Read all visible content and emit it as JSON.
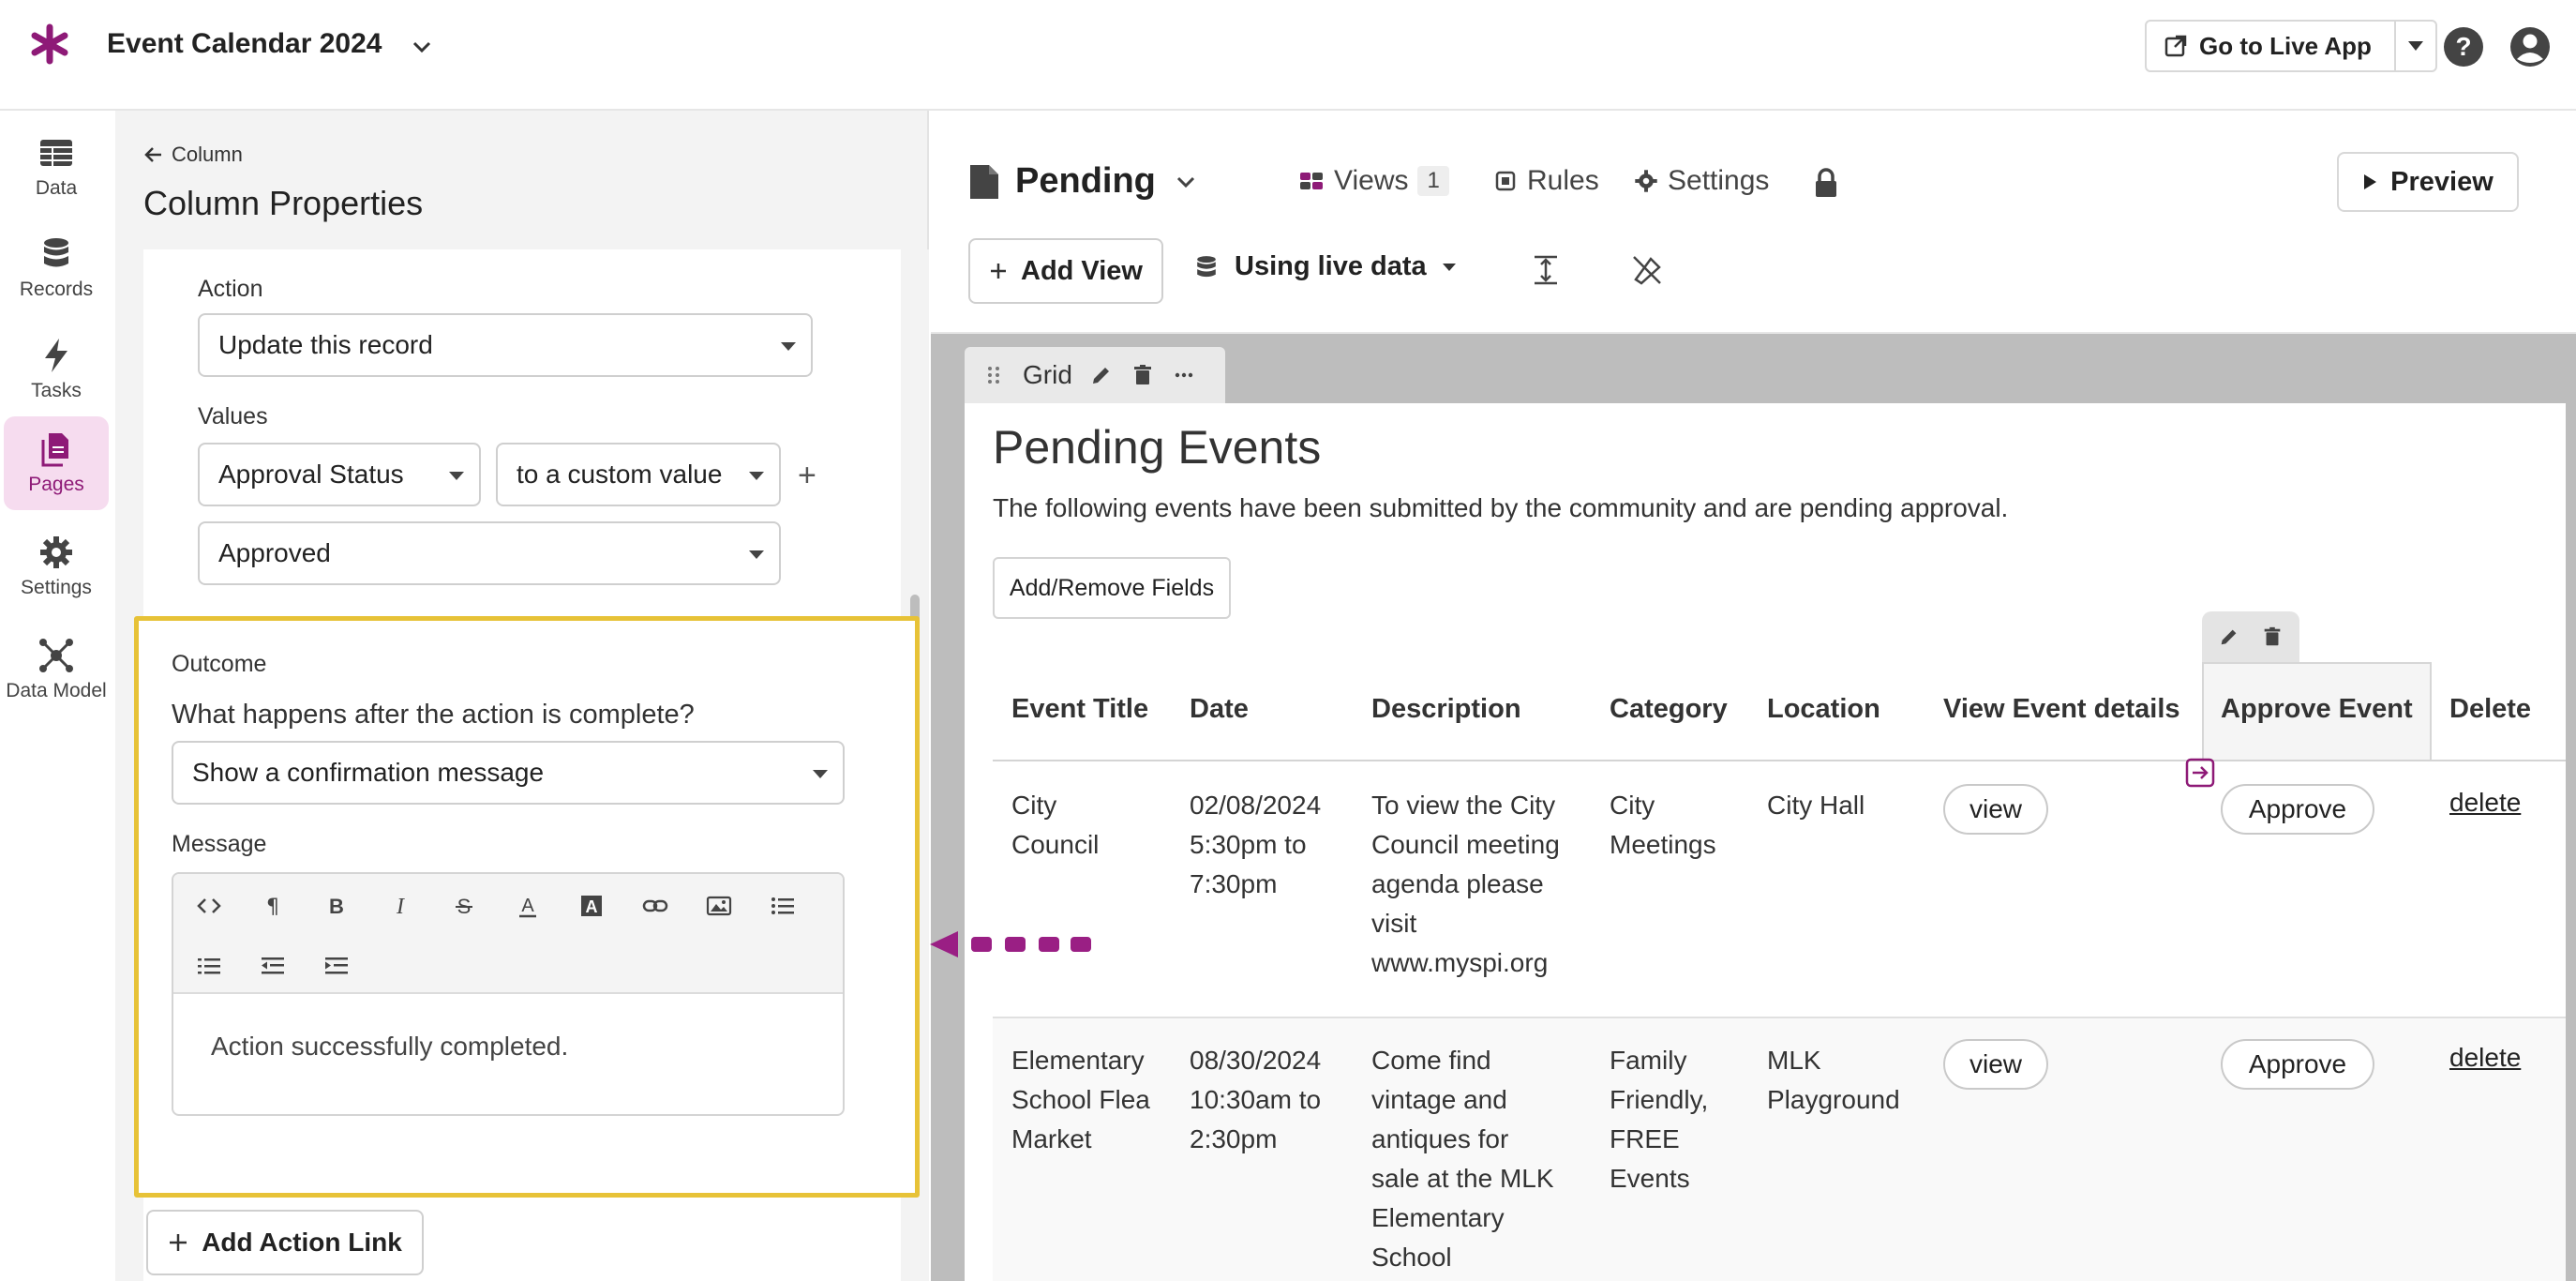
{
  "app": {
    "title": "Event Calendar 2024",
    "brand_color": "#8e1a77",
    "go_live_label": "Go to Live App"
  },
  "nav": {
    "items": [
      {
        "label": "Data",
        "icon": "table-icon",
        "active": false
      },
      {
        "label": "Records",
        "icon": "database-icon",
        "active": false
      },
      {
        "label": "Tasks",
        "icon": "bolt-icon",
        "active": false
      },
      {
        "label": "Pages",
        "icon": "pages-icon",
        "active": true
      },
      {
        "label": "Settings",
        "icon": "gear-icon",
        "active": false
      },
      {
        "label": "Data Model",
        "icon": "data-model-icon",
        "active": false
      }
    ]
  },
  "panel": {
    "back_label": "Column",
    "title": "Column Properties",
    "action_label": "Action",
    "action_value": "Update this record",
    "values_label": "Values",
    "field_value": "Approval Status",
    "mode_value": "to a custom value",
    "custom_value": "Approved",
    "outcome_label": "Outcome",
    "outcome_question": "What happens after the action is complete?",
    "outcome_value": "Show a confirmation message",
    "message_label": "Message",
    "message_text": "Action successfully completed.",
    "add_action_label": "Add Action Link",
    "highlight_color": "#e7c237"
  },
  "page": {
    "name": "Pending",
    "views_label": "Views",
    "views_count": "1",
    "rules_label": "Rules",
    "settings_label": "Settings",
    "preview_label": "Preview",
    "add_view_label": "Add View",
    "data_source_label": "Using live data"
  },
  "view": {
    "tab_label": "Grid",
    "title": "Pending Events",
    "description": "The following events have been submitted by the community and are pending approval.",
    "fields_button": "Add/Remove Fields",
    "columns": [
      "Event Title",
      "Date",
      "Description",
      "Category",
      "Location",
      "View Event details",
      "Approve Event",
      "Delete"
    ],
    "rows": [
      {
        "title": [
          "City",
          "Council"
        ],
        "date": [
          "02/08/2024",
          "5:30pm to",
          "7:30pm"
        ],
        "description": [
          "To view the City",
          "Council meeting",
          "agenda please",
          "visit",
          "www.myspi.org"
        ],
        "category": [
          "City",
          "Meetings"
        ],
        "location": [
          "City Hall"
        ],
        "view": "view",
        "approve": "Approve",
        "delete": "delete"
      },
      {
        "title": [
          "Elementary",
          "School Flea",
          "Market"
        ],
        "date": [
          "08/30/2024",
          "10:30am to",
          "2:30pm"
        ],
        "description": [
          "Come find",
          "vintage and",
          "antiques for",
          "sale at the MLK",
          "Elementary",
          "School"
        ],
        "category": [
          "Family",
          "Friendly,",
          "FREE",
          "Events"
        ],
        "location": [
          "MLK",
          "Playground"
        ],
        "view": "view",
        "approve": "Approve",
        "delete": "delete"
      }
    ]
  }
}
